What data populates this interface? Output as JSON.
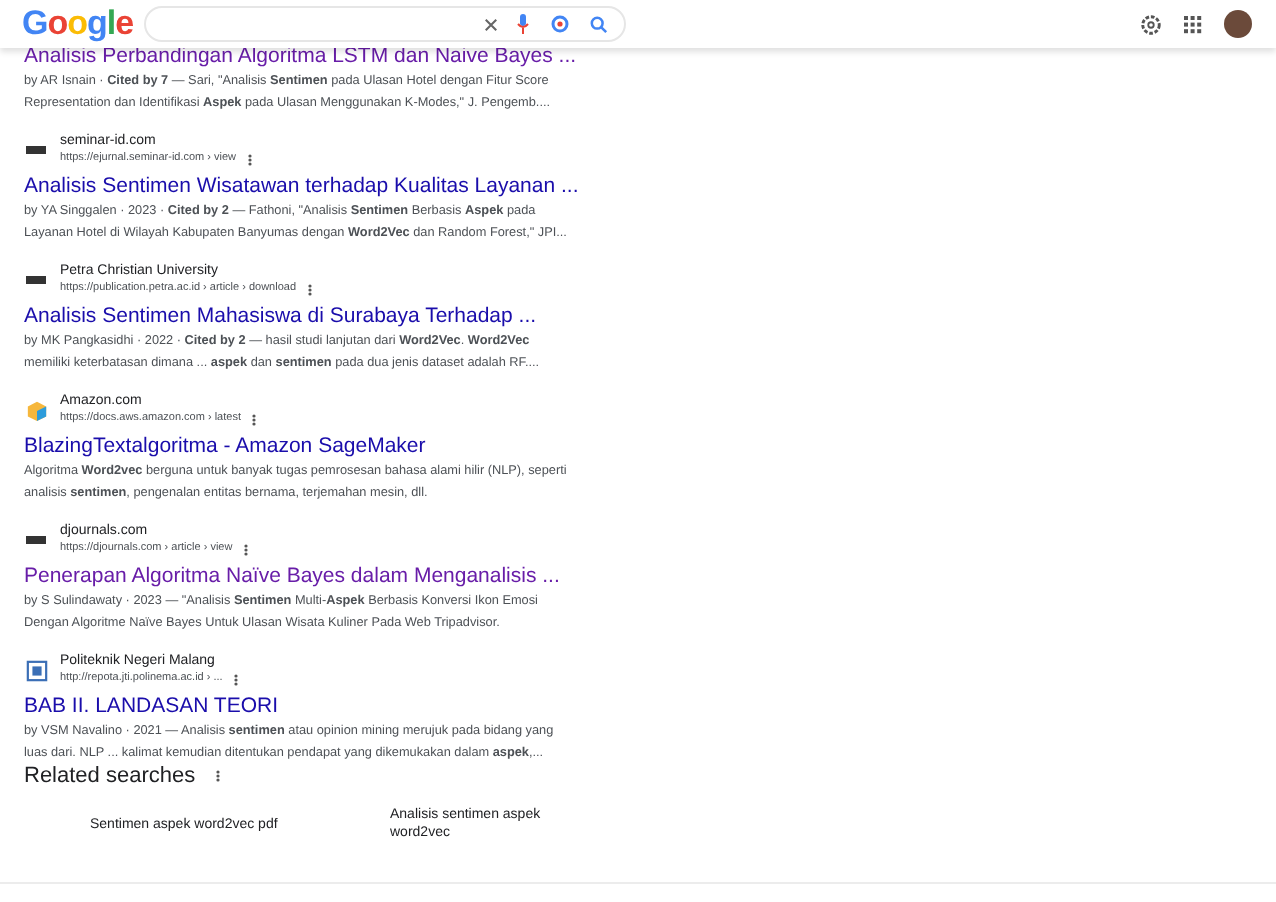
{
  "header": {
    "logo": "Google"
  },
  "results": [
    {
      "kind": "plain",
      "title": "Analisis Perbandingan Algoritma LSTM dan Naive Bayes ...",
      "visited": true,
      "snippet": [
        "by AR Isnain · **Cited by 7** — Sari, \"Analisis **Sentimen** pada Ulasan Hotel dengan Fitur Score",
        "Representation dan Identifikasi **Aspek** pada Ulasan Menggunakan K-Modes,\" J. Pengemb...."
      ]
    },
    {
      "site": "seminar-id.com",
      "url": "https://ejurnal.seminar-id.com › view",
      "kind": "pkp",
      "title": "Analisis Sentimen Wisatawan terhadap Kualitas Layanan ...",
      "visited": false,
      "snippet": [
        "by YA Singgalen · 2023 · **Cited by 2** — Fathoni, \"Analisis **Sentimen** Berbasis **Aspek** pada",
        "Layanan Hotel di Wilayah Kabupaten Banyumas dengan **Word2Vec** dan Random Forest,\" JPI..."
      ]
    },
    {
      "site": "Petra Christian University",
      "url": "https://publication.petra.ac.id › article › download",
      "kind": "pkp",
      "title": "Analisis Sentimen Mahasiswa di Surabaya Terhadap ...",
      "visited": false,
      "snippet": [
        "by MK Pangkasidhi · 2022 · **Cited by 2** — hasil studi lanjutan dari **Word2Vec**. **Word2Vec**",
        "memiliki keterbatasan dimana ... **aspek** dan **sentimen** pada dua jenis dataset adalah RF...."
      ]
    },
    {
      "site": "Amazon.com",
      "url": "https://docs.aws.amazon.com › latest",
      "kind": "cube",
      "title": "BlazingTextalgoritma - Amazon SageMaker",
      "visited": false,
      "snippet": [
        "Algoritma **Word2vec** berguna untuk banyak tugas pemrosesan bahasa alami hilir (NLP), seperti",
        "analisis **sentimen**, pengenalan entitas bernama, terjemahan mesin, dll."
      ]
    },
    {
      "site": "djournals.com",
      "url": "https://djournals.com › article › view",
      "kind": "pkp",
      "title": "Penerapan Algoritma Naïve Bayes dalam Menganalisis ...",
      "visited": true,
      "snippet": [
        "by S Sulindawaty · 2023 — \"Analisis **Sentimen** Multi-**Aspek** Berbasis Konversi Ikon Emosi",
        "Dengan Algoritme Naïve Bayes Untuk Ulasan Wisata Kuliner Pada Web Tripadvisor."
      ]
    },
    {
      "site": "Politeknik Negeri Malang",
      "url": "http://repota.jti.polinema.ac.id › ...",
      "kind": "doc",
      "title": "BAB II. LANDASAN TEORI",
      "visited": false,
      "snippet": [
        "by VSM Navalino · 2021 — Analisis **sentimen** atau opinion mining merujuk pada bidang yang",
        "luas dari. NLP ... kalimat kemudian ditentukan pendapat yang dikemukakan dalam **aspek**,..."
      ]
    }
  ],
  "related": {
    "heading": "Related searches",
    "items": [
      "Sentimen aspek word2vec pdf",
      "Analisis sentimen aspek word2vec"
    ]
  }
}
